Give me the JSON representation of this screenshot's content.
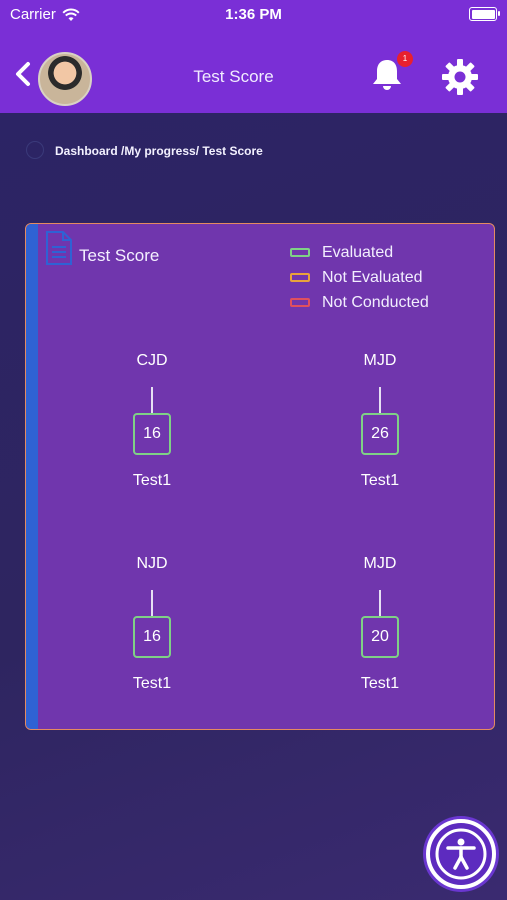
{
  "status_bar": {
    "carrier": "Carrier",
    "time": "1:36 PM"
  },
  "header": {
    "title": "Test Score",
    "notification_count": "1"
  },
  "breadcrumb": "Dashboard /My progress/ Test Score",
  "card": {
    "title": "Test Score",
    "legend": [
      {
        "label": "Evaluated",
        "color": "#7fd186"
      },
      {
        "label": "Not Evaluated",
        "color": "#e9a23b"
      },
      {
        "label": "Not Conducted",
        "color": "#e0505e"
      }
    ],
    "items": [
      {
        "subject": "CJD",
        "score": "16",
        "test": "Test1",
        "status": "Evaluated"
      },
      {
        "subject": "MJD",
        "score": "26",
        "test": "Test1",
        "status": "Evaluated"
      },
      {
        "subject": "NJD",
        "score": "16",
        "test": "Test1",
        "status": "Evaluated"
      },
      {
        "subject": "MJD",
        "score": "20",
        "test": "Test1",
        "status": "Evaluated"
      }
    ]
  },
  "colors": {
    "header_bg": "#7a2fd6",
    "card_bg": "#7036ad",
    "card_border": "#e58b60",
    "accent_bar": "#2f62d4"
  },
  "icons": [
    "back-chevron-icon",
    "avatar",
    "bell-icon",
    "gear-icon",
    "document-icon",
    "accessibility-icon"
  ]
}
